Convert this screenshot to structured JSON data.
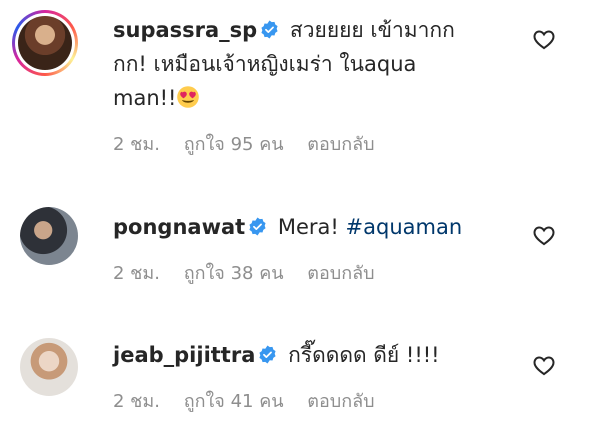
{
  "comments": [
    {
      "username": "supassra_sp",
      "verified": true,
      "lines": [
        "สวยยยย เข้ามากก",
        "กก! เหมือนเจ้าหญิงเมร่า ในaqua",
        "man!!"
      ],
      "emoji": "heart-eyes",
      "time": "2 ชม.",
      "likes": "ถูกใจ 95 คน",
      "reply": "ตอบกลับ"
    },
    {
      "username": "pongnawat",
      "verified": true,
      "text": "Mera!",
      "hashtag": "#aquaman",
      "time": "2 ชม.",
      "likes": "ถูกใจ 38 คน",
      "reply": "ตอบกลับ"
    },
    {
      "username": "jeab_pijittra",
      "verified": true,
      "text": "กรี๊ดดดด ดีย์ !!!!",
      "time": "2 ชม.",
      "likes": "ถูกใจ 41 คน",
      "reply": "ตอบกลับ"
    }
  ],
  "colors": {
    "verified": "#3897f0",
    "hashtag": "#00376b",
    "meta": "#8e8e8e",
    "text": "#262626"
  }
}
